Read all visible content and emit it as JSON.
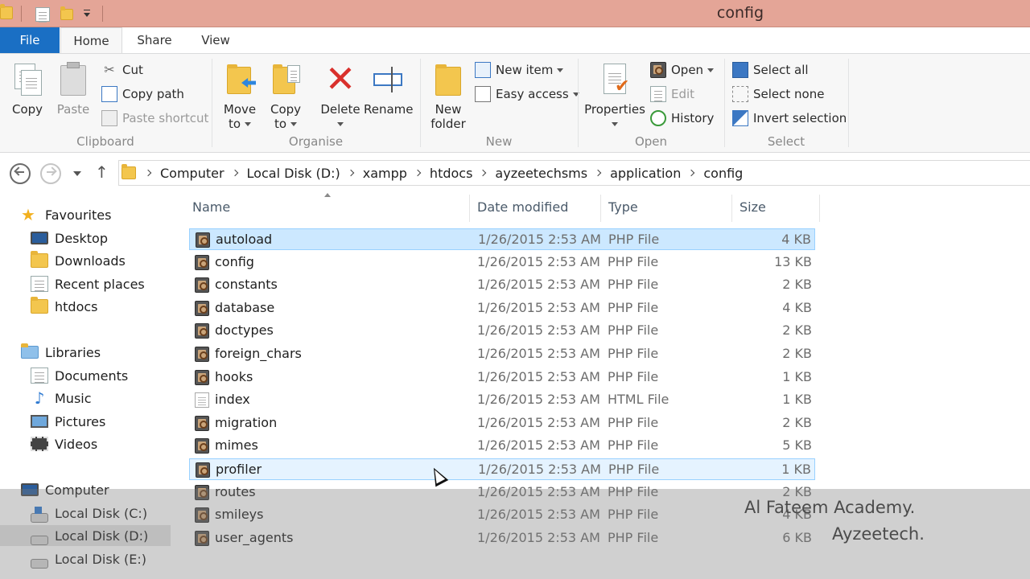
{
  "window": {
    "title": "config"
  },
  "tabs": {
    "file": "File",
    "home": "Home",
    "share": "Share",
    "view": "View"
  },
  "ribbon": {
    "clipboard": {
      "label": "Clipboard",
      "copy": "Copy",
      "paste": "Paste",
      "cut": "Cut",
      "copy_path": "Copy path",
      "paste_shortcut": "Paste shortcut"
    },
    "organise": {
      "label": "Organise",
      "move_to_1": "Move",
      "move_to_2": "to",
      "copy_to_1": "Copy",
      "copy_to_2": "to",
      "delete": "Delete",
      "rename": "Rename"
    },
    "new": {
      "label": "New",
      "new_folder_1": "New",
      "new_folder_2": "folder",
      "new_item": "New item",
      "easy_access": "Easy access"
    },
    "open": {
      "label": "Open",
      "properties": "Properties",
      "open": "Open",
      "edit": "Edit",
      "history": "History"
    },
    "select": {
      "label": "Select",
      "select_all": "Select all",
      "select_none": "Select none",
      "invert_selection": "Invert selection"
    }
  },
  "breadcrumb": [
    "Computer",
    "Local Disk (D:)",
    "xampp",
    "htdocs",
    "ayzeetechsms",
    "application",
    "config"
  ],
  "nav": {
    "favourites": "Favourites",
    "desktop": "Desktop",
    "downloads": "Downloads",
    "recent": "Recent places",
    "htdocs": "htdocs",
    "libraries": "Libraries",
    "documents": "Documents",
    "music": "Music",
    "pictures": "Pictures",
    "videos": "Videos",
    "computer": "Computer",
    "disk_c": "Local Disk (C:)",
    "disk_d": "Local Disk (D:)",
    "disk_e": "Local Disk (E:)"
  },
  "columns": {
    "name": "Name",
    "date": "Date modified",
    "type": "Type",
    "size": "Size"
  },
  "files": [
    {
      "name": "autoload",
      "date": "1/26/2015 2:53 AM",
      "type": "PHP File",
      "size": "4 KB"
    },
    {
      "name": "config",
      "date": "1/26/2015 2:53 AM",
      "type": "PHP File",
      "size": "13 KB"
    },
    {
      "name": "constants",
      "date": "1/26/2015 2:53 AM",
      "type": "PHP File",
      "size": "2 KB"
    },
    {
      "name": "database",
      "date": "1/26/2015 2:53 AM",
      "type": "PHP File",
      "size": "4 KB"
    },
    {
      "name": "doctypes",
      "date": "1/26/2015 2:53 AM",
      "type": "PHP File",
      "size": "2 KB"
    },
    {
      "name": "foreign_chars",
      "date": "1/26/2015 2:53 AM",
      "type": "PHP File",
      "size": "2 KB"
    },
    {
      "name": "hooks",
      "date": "1/26/2015 2:53 AM",
      "type": "PHP File",
      "size": "1 KB"
    },
    {
      "name": "index",
      "date": "1/26/2015 2:53 AM",
      "type": "HTML File",
      "size": "1 KB"
    },
    {
      "name": "migration",
      "date": "1/26/2015 2:53 AM",
      "type": "PHP File",
      "size": "2 KB"
    },
    {
      "name": "mimes",
      "date": "1/26/2015 2:53 AM",
      "type": "PHP File",
      "size": "5 KB"
    },
    {
      "name": "profiler",
      "date": "1/26/2015 2:53 AM",
      "type": "PHP File",
      "size": "1 KB"
    },
    {
      "name": "routes",
      "date": "1/26/2015 2:53 AM",
      "type": "PHP File",
      "size": "2 KB"
    },
    {
      "name": "smileys",
      "date": "1/26/2015 2:53 AM",
      "type": "PHP File",
      "size": "4 KB"
    },
    {
      "name": "user_agents",
      "date": "1/26/2015 2:53 AM",
      "type": "PHP File",
      "size": "6 KB"
    }
  ],
  "watermark": {
    "line1": "Al Fateem Academy.",
    "line2": "Ayzeetech."
  }
}
